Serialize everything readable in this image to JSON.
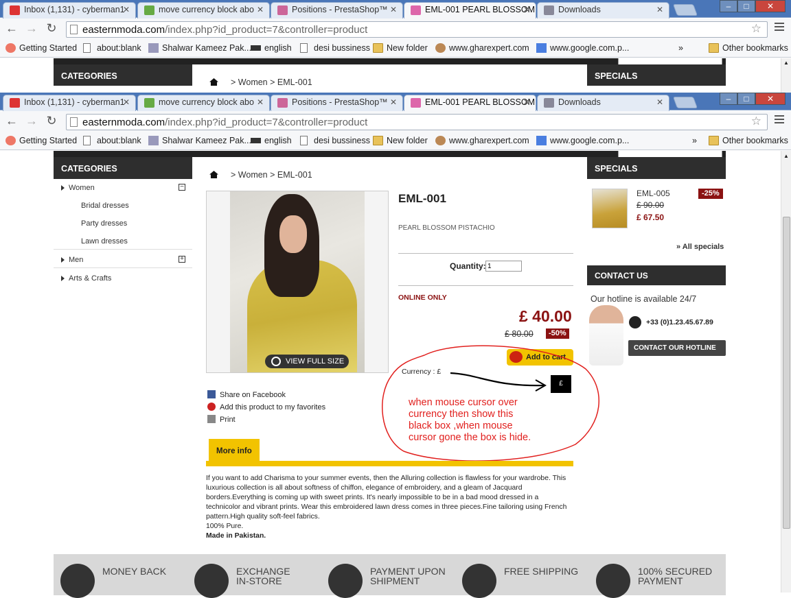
{
  "browser": {
    "tabs": [
      {
        "label": "Inbox (1,131) - cyberman1",
        "icon": "gmail-icon",
        "active": false
      },
      {
        "label": "move currency block abo",
        "icon": "prestashop-forum-icon",
        "active": false
      },
      {
        "label": "Positions - PrestaShop™",
        "icon": "prestashop-icon",
        "active": false
      },
      {
        "label": "EML-001 PEARL BLOSSOM",
        "icon": "site-favicon-icon",
        "active": true
      },
      {
        "label": "Downloads",
        "icon": "download-icon",
        "active": false
      }
    ],
    "window_buttons": {
      "minimize": "–",
      "maximize": "□",
      "close": "✕"
    },
    "url_domain": "easternmoda.com",
    "url_path": "/index.php?id_product=7&controller=product",
    "bookmarks": [
      {
        "label": "Getting Started",
        "icon": "firefox-icon"
      },
      {
        "label": "about:blank",
        "icon": "page-icon"
      },
      {
        "label": "Shalwar Kameez Pak...",
        "icon": "site-icon"
      },
      {
        "label": "english",
        "icon": "site-icon"
      },
      {
        "label": "desi bussiness",
        "icon": "page-icon"
      },
      {
        "label": "New folder",
        "icon": "folder-icon"
      },
      {
        "label": "www.gharexpert.com",
        "icon": "site-icon"
      },
      {
        "label": "www.google.com.p...",
        "icon": "google-icon"
      }
    ],
    "overflow": "»",
    "other_bookmarks": "Other bookmarks"
  },
  "site": {
    "categories_title": "CATEGORIES",
    "specials_title": "SPECIALS",
    "breadcrumb": {
      "sep": ">",
      "items": [
        "Women",
        "EML-001"
      ]
    },
    "categories": [
      {
        "label": "Women",
        "toggle": "−",
        "children": [
          "Bridal dresses",
          "Party dresses",
          "Lawn dresses"
        ]
      },
      {
        "label": "Men",
        "toggle": "+"
      },
      {
        "label": "Arts & Crafts"
      }
    ]
  },
  "product": {
    "title": "EML-001",
    "subtitle": "PEARL BLOSSOM PISTACHIO",
    "quantity_label": "Quantity:",
    "quantity_value": "1",
    "online_only": "ONLINE ONLY",
    "price": "£ 40.00",
    "old_price": "£ 80.00",
    "discount": "-50%",
    "add_to_cart": "Add to cart",
    "view_full_size": "VIEW FULL SIZE",
    "currency_label": "Currency : £",
    "currency_box": "£",
    "actions": [
      "Share on Facebook",
      "Add this product to my favorites",
      "Print"
    ],
    "more_info_tab": "More info",
    "description": "If you want to add Charisma to your summer events, then the Alluring collection is flawless for your wardrobe.  This luxurious collection is all about softness of chiffon, elegance of embroidery, and a gleam of Jacquard borders.Everything is coming up with sweet prints. It's nearly impossible to be in a bad mood dressed in a technicolor and vibrant prints. Wear this embroidered lawn dress comes in three pieces.Fine tailoring using French pattern.High quality soft-feel fabrics.",
    "pure": "100% Pure.",
    "made_in": "Made in Pakistan."
  },
  "annotation": "when mouse cursor over currency then show this black box ,when mouse cursor gone the box is hide.",
  "specials": {
    "name": "EML-005",
    "old_price": "£ 90.00",
    "new_price": "£ 67.50",
    "discount": "-25%",
    "all_link": "» All specials"
  },
  "contact": {
    "title": "CONTACT US",
    "hotline_text": "Our hotline is available 24/7",
    "phone": "+33 (0)1.23.45.67.89",
    "button": "CONTACT OUR HOTLINE"
  },
  "footer": [
    {
      "label": "MONEY BACK",
      "icon": "smiley-icon"
    },
    {
      "label": "EXCHANGE IN-STORE",
      "icon": "refresh-icon"
    },
    {
      "label": "PAYMENT UPON SHIPMENT",
      "icon": "payment-icon"
    },
    {
      "label": "FREE SHIPPING",
      "icon": "truck-icon"
    },
    {
      "label": "100% SECURED PAYMENT",
      "icon": "lock-icon"
    }
  ],
  "colors": {
    "accent_yellow": "#f2c300",
    "price_red": "#8b1212",
    "annotation_red": "#e1201e",
    "header_dark": "#2e2e2e"
  }
}
